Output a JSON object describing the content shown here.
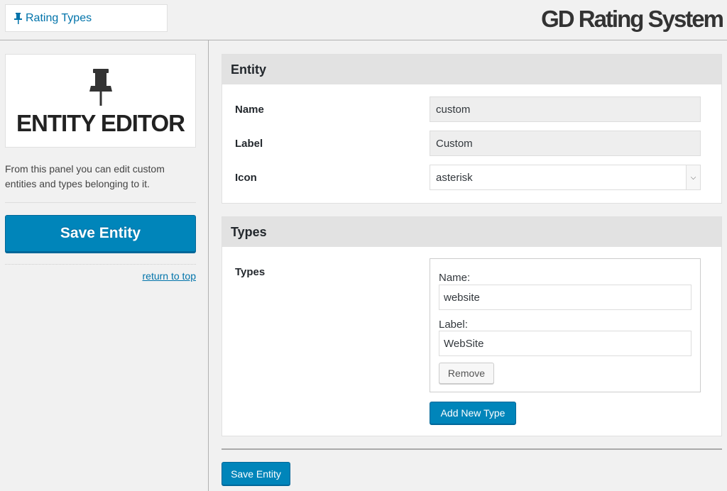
{
  "header": {
    "breadcrumb": "Rating Types",
    "breadcrumb_icon": "pushpin-icon",
    "brand": "GD Rating System"
  },
  "sidebar": {
    "logo_icon": "pushpin-icon",
    "logo_title": "ENTITY EDITOR",
    "description": "From this panel you can edit custom entities and types belonging to it.",
    "save_label": "Save Entity",
    "return_label": "return to top"
  },
  "entity_panel": {
    "title": "Entity",
    "name_label": "Name",
    "name_value": "custom",
    "label_label": "Label",
    "label_value": "Custom",
    "icon_label": "Icon",
    "icon_value": "asterisk"
  },
  "types_panel": {
    "title": "Types",
    "row_label": "Types",
    "item": {
      "name_label": "Name:",
      "name_value": "website",
      "label_label": "Label:",
      "label_value": "WebSite",
      "remove_label": "Remove"
    },
    "add_label": "Add New Type"
  },
  "footer": {
    "save_label": "Save Entity"
  },
  "colors": {
    "accent": "#0085ba",
    "link": "#0073aa",
    "panel_header": "#e2e2e2",
    "background": "#f1f1f1"
  }
}
